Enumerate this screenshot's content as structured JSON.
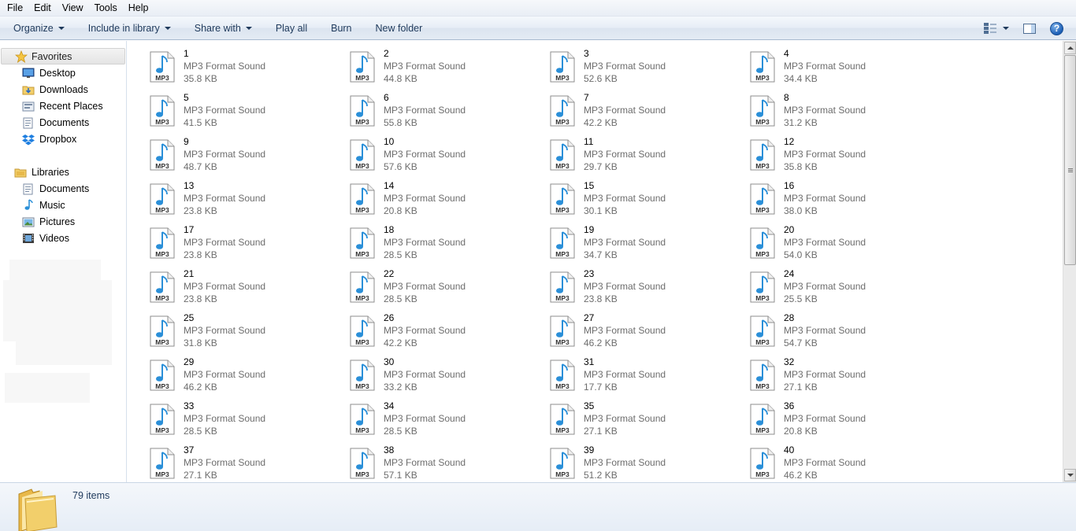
{
  "menu": [
    "File",
    "Edit",
    "View",
    "Tools",
    "Help"
  ],
  "toolbar": {
    "organize": "Organize",
    "include_in_library": "Include in library",
    "share_with": "Share with",
    "play_all": "Play all",
    "burn": "Burn",
    "new_folder": "New folder",
    "help_glyph": "?"
  },
  "nav": {
    "favorites": {
      "label": "Favorites",
      "items": [
        "Desktop",
        "Downloads",
        "Recent Places",
        "Documents",
        "Dropbox"
      ]
    },
    "libraries": {
      "label": "Libraries",
      "items": [
        "Documents",
        "Music",
        "Pictures",
        "Videos"
      ]
    }
  },
  "file_type": "MP3 Format Sound",
  "icon_badge": "MP3",
  "files": [
    {
      "name": "1",
      "size": "35.8 KB"
    },
    {
      "name": "2",
      "size": "44.8 KB"
    },
    {
      "name": "3",
      "size": "52.6 KB"
    },
    {
      "name": "4",
      "size": "34.4 KB"
    },
    {
      "name": "5",
      "size": "41.5 KB"
    },
    {
      "name": "6",
      "size": "55.8 KB"
    },
    {
      "name": "7",
      "size": "42.2 KB"
    },
    {
      "name": "8",
      "size": "31.2 KB"
    },
    {
      "name": "9",
      "size": "48.7 KB"
    },
    {
      "name": "10",
      "size": "57.6 KB"
    },
    {
      "name": "11",
      "size": "29.7 KB"
    },
    {
      "name": "12",
      "size": "35.8 KB"
    },
    {
      "name": "13",
      "size": "23.8 KB"
    },
    {
      "name": "14",
      "size": "20.8 KB"
    },
    {
      "name": "15",
      "size": "30.1 KB"
    },
    {
      "name": "16",
      "size": "38.0 KB"
    },
    {
      "name": "17",
      "size": "23.8 KB"
    },
    {
      "name": "18",
      "size": "28.5 KB"
    },
    {
      "name": "19",
      "size": "34.7 KB"
    },
    {
      "name": "20",
      "size": "54.0 KB"
    },
    {
      "name": "21",
      "size": "23.8 KB"
    },
    {
      "name": "22",
      "size": "28.5 KB"
    },
    {
      "name": "23",
      "size": "23.8 KB"
    },
    {
      "name": "24",
      "size": "25.5 KB"
    },
    {
      "name": "25",
      "size": "31.8 KB"
    },
    {
      "name": "26",
      "size": "42.2 KB"
    },
    {
      "name": "27",
      "size": "46.2 KB"
    },
    {
      "name": "28",
      "size": "54.7 KB"
    },
    {
      "name": "29",
      "size": "46.2 KB"
    },
    {
      "name": "30",
      "size": "33.2 KB"
    },
    {
      "name": "31",
      "size": "17.7 KB"
    },
    {
      "name": "32",
      "size": "27.1 KB"
    },
    {
      "name": "33",
      "size": "28.5 KB"
    },
    {
      "name": "34",
      "size": "28.5 KB"
    },
    {
      "name": "35",
      "size": "27.1 KB"
    },
    {
      "name": "36",
      "size": "20.8 KB"
    },
    {
      "name": "37",
      "size": "27.1 KB"
    },
    {
      "name": "38",
      "size": "57.1 KB"
    },
    {
      "name": "39",
      "size": "51.2 KB"
    },
    {
      "name": "40",
      "size": "46.2 KB"
    }
  ],
  "status": {
    "item_count": "79 items"
  },
  "colors": {
    "accent_text": "#1e395b",
    "note_blue": "#2a8fd8",
    "folder_yellow": "#f2cf6b"
  }
}
